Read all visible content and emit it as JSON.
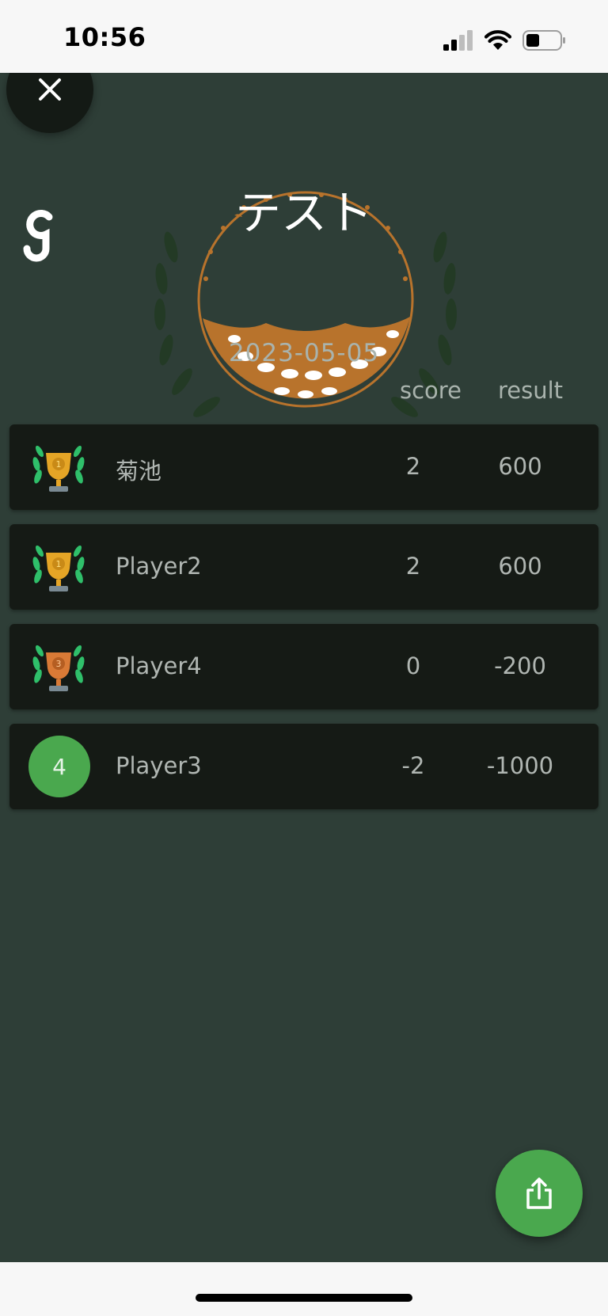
{
  "status_bar": {
    "time": "10:56",
    "icons": [
      "cellular-signal-icon",
      "wifi-icon",
      "battery-icon"
    ]
  },
  "header": {
    "close_icon": "close-icon",
    "logo_icon": "app-logo-icon",
    "event_title": "テスト",
    "event_date": "2023-05-05",
    "columns": {
      "score": "score",
      "result": "result"
    }
  },
  "players": [
    {
      "rank": 1,
      "rank_icon": "gold-trophy-icon",
      "name": "菊池",
      "score": "2",
      "result": "600"
    },
    {
      "rank": 1,
      "rank_icon": "gold-trophy-icon",
      "name": "Player2",
      "score": "2",
      "result": "600"
    },
    {
      "rank": 3,
      "rank_icon": "bronze-trophy-icon",
      "name": "Player4",
      "score": "0",
      "result": "-200"
    },
    {
      "rank": 4,
      "rank_label": "4",
      "name": "Player3",
      "score": "-2",
      "result": "-1000"
    }
  ],
  "actions": {
    "share_icon": "share-icon"
  },
  "colors": {
    "background": "#2e3e37",
    "row_background": "#151a15",
    "accent_green": "#4aa84e",
    "gold": "#e5a526",
    "bronze": "#d97a36",
    "emblem_brown": "#b8732c"
  }
}
